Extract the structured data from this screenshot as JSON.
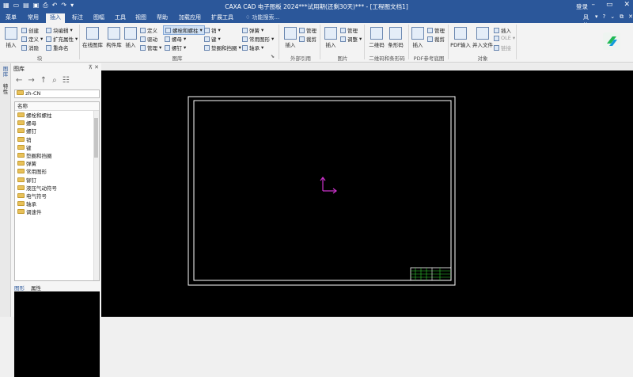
{
  "titlebar": {
    "title": "CAXA CAD 电子图板 2024***试用期(还剩30天)*** - [工程图文档1]",
    "login": "登录"
  },
  "tabs": [
    "菜单",
    "常用",
    "插入",
    "标注",
    "图幅",
    "工具",
    "视图",
    "帮助",
    "加载应用",
    "扩展工具"
  ],
  "search_placeholder": "功能搜索...",
  "style_label": "风格",
  "ribbon": {
    "insert_big": "插入",
    "create": "创建",
    "block_edit": "块编辑",
    "define": "定义",
    "expand_attr": "扩充属性",
    "eliminate": "消隐",
    "rename": "重命名",
    "group_block": "块",
    "online_lib": "在线图库",
    "part_lib": "构件库",
    "lib_insert": "插入",
    "lib_define": "定义",
    "lib_drive": "驱动",
    "lib_manage": "管理",
    "std_bolt": "螺栓和螺柱",
    "std_nut": "螺母",
    "std_rivet": "螺钉",
    "pin": "销",
    "key": "键",
    "washer": "垫圈和挡圈",
    "spring": "弹簧",
    "common": "常用图形",
    "bearing": "轴承",
    "group_lib": "图库",
    "xref_insert": "插入",
    "xref_manage": "管理",
    "xref_clip": "裁剪",
    "group_xref": "外部引用",
    "img_insert": "插入",
    "img_manage": "管理",
    "img_adjust": "调整",
    "group_img": "图片",
    "qr": "二维码",
    "barcode": "条形码",
    "group_code": "二维码和条形码",
    "pdf_insert": "PDF输入",
    "pdf_manage": "管理",
    "pdf_clip": "裁剪",
    "group_pdf": "PDF参考底图",
    "ins_obj": "插入",
    "open_file": "并入文件",
    "obj_insert": "插入",
    "obj_ole": "OLE",
    "obj_link": "链接",
    "group_obj": "对象"
  },
  "sidebar": {
    "tab1": "图库",
    "tab2": "特性"
  },
  "panel": {
    "title": "图库",
    "path": "zh-CN",
    "header": "名称",
    "items": [
      "螺栓和螺柱",
      "螺母",
      "螺钉",
      "销",
      "键",
      "垫圈和挡圈",
      "弹簧",
      "常用图形",
      "铆钉",
      "液压气动符号",
      "电气符号",
      "轴承",
      "调速件"
    ],
    "tab_graphic": "图形",
    "tab_attr": "属性"
  },
  "colors": {
    "accent": "#2b579a",
    "sheet_border": "#ffffff",
    "title_block": "#33cc33",
    "origin": "#cc33cc"
  }
}
